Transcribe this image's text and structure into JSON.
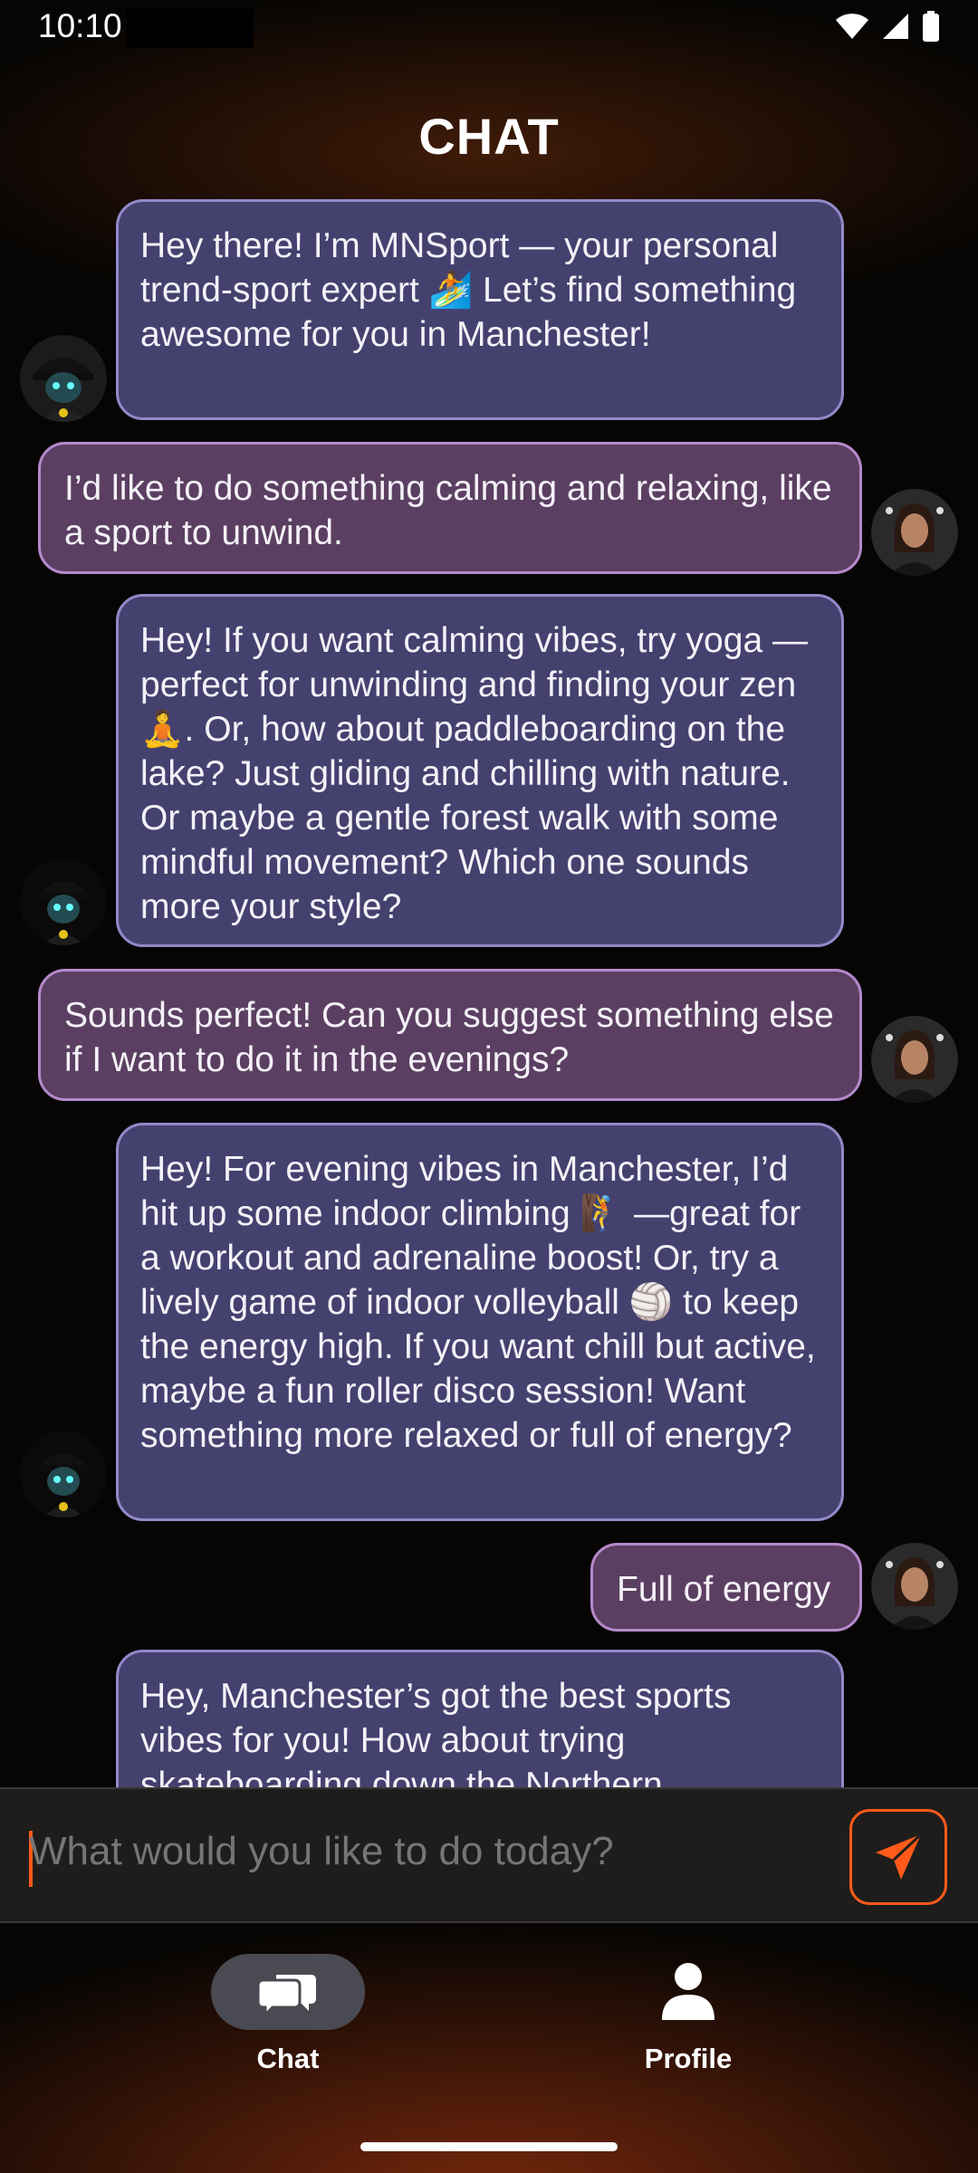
{
  "status_bar": {
    "time": "10:10"
  },
  "header": {
    "title": "CHAT"
  },
  "messages": [
    {
      "sender": "bot",
      "text": "Hey there! I’m MNSport — your personal trend-sport expert 🏄 Let’s find something awesome for you in Manchester!"
    },
    {
      "sender": "user",
      "text": "I’d like to do something calming and relaxing, like a sport to unwind."
    },
    {
      "sender": "bot",
      "text": "Hey! If you want calming vibes, try yoga — perfect for unwinding and finding your zen 🧘. Or, how about paddleboarding on the lake? Just gliding and chilling with nature. Or maybe a gentle forest walk with some mindful movement? Which one sounds more your style?"
    },
    {
      "sender": "user",
      "text": "Sounds perfect! Can you suggest something else if I want to do it in the evenings?"
    },
    {
      "sender": "bot",
      "text": "Hey! For evening vibes in Manchester, I’d hit up some indoor climbing 🧗 —great for a workout and adrenaline boost! Or, try a lively game of indoor volleyball 🏐 to keep the energy high. If you want chill but active, maybe a fun roller disco session! Want something more relaxed or full of energy?"
    },
    {
      "sender": "user",
      "text": "Full of energy"
    },
    {
      "sender": "bot",
      "text": "Hey, Manchester’s got the best sports vibes for you! How about trying skateboarding down the Northern"
    }
  ],
  "input": {
    "placeholder": "What would you like to do today?"
  },
  "nav": {
    "chat_label": "Chat",
    "profile_label": "Profile"
  },
  "colors": {
    "accent": "#ff5a1a",
    "bot_bubble": "#44416f",
    "user_bubble": "#5b3f62"
  },
  "icons": {
    "send": "send-icon",
    "chat": "chat-bubbles-icon",
    "profile": "person-icon"
  }
}
